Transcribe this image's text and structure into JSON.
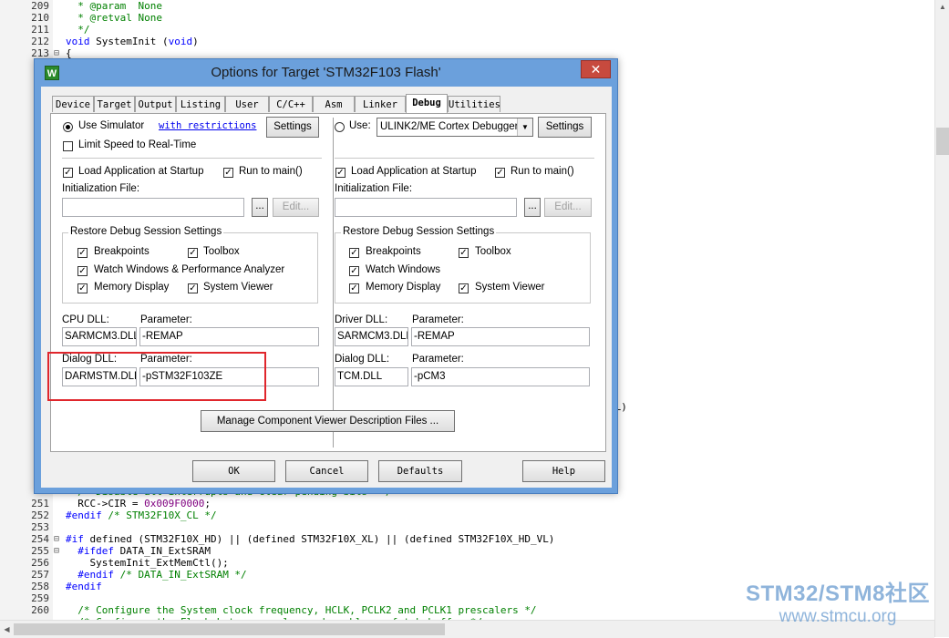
{
  "editor": {
    "lines": [
      {
        "n": "209",
        "fold": "",
        "html": [
          {
            "t": "  * @param  None",
            "c": "cmt"
          }
        ]
      },
      {
        "n": "210",
        "fold": "",
        "html": [
          {
            "t": "  * @retval None",
            "c": "cmt"
          }
        ]
      },
      {
        "n": "211",
        "fold": "",
        "html": [
          {
            "t": "  */",
            "c": "cmt"
          }
        ]
      },
      {
        "n": "212",
        "fold": "",
        "html": [
          {
            "t": "void",
            "c": "kw"
          },
          {
            "t": " SystemInit (",
            "c": ""
          },
          {
            "t": "void",
            "c": "kw"
          },
          {
            "t": ")",
            "c": ""
          }
        ]
      },
      {
        "n": "213",
        "fold": "⊟",
        "html": [
          {
            "t": "{",
            "c": ""
          }
        ]
      },
      {
        "n": "",
        "fold": "",
        "html": [
          {
            "t": "  /* Disable all interrupts and clear pending bits  */",
            "c": "cmt"
          }
        ]
      },
      {
        "n": "251",
        "fold": "",
        "html": [
          {
            "t": "  RCC->CIR = ",
            "c": ""
          },
          {
            "t": "0x009F0000",
            "c": "num"
          },
          {
            "t": ";",
            "c": ""
          }
        ]
      },
      {
        "n": "252",
        "fold": "",
        "html": [
          {
            "t": "#endif",
            "c": "pp"
          },
          {
            "t": " /* STM32F10X_CL */",
            "c": "cmt"
          }
        ]
      },
      {
        "n": "253",
        "fold": "",
        "html": [
          {
            "t": "",
            "c": ""
          }
        ]
      },
      {
        "n": "254",
        "fold": "⊟",
        "html": [
          {
            "t": "#if",
            "c": "pp"
          },
          {
            "t": " defined (STM32F10X_HD) || (defined STM32F10X_XL) || (defined STM32F10X_HD_VL)",
            "c": ""
          }
        ]
      },
      {
        "n": "255",
        "fold": "⊟",
        "html": [
          {
            "t": "  #ifdef",
            "c": "pp"
          },
          {
            "t": " DATA_IN_ExtSRAM",
            "c": ""
          }
        ]
      },
      {
        "n": "256",
        "fold": "",
        "html": [
          {
            "t": "    SystemInit_ExtMemCtl();",
            "c": ""
          }
        ]
      },
      {
        "n": "257",
        "fold": "",
        "html": [
          {
            "t": "  #endif",
            "c": "pp"
          },
          {
            "t": " /* DATA_IN_ExtSRAM */",
            "c": "cmt"
          }
        ]
      },
      {
        "n": "258",
        "fold": "",
        "html": [
          {
            "t": "#endif",
            "c": "pp"
          }
        ]
      },
      {
        "n": "259",
        "fold": "",
        "html": [
          {
            "t": "",
            "c": ""
          }
        ]
      },
      {
        "n": "260",
        "fold": "",
        "html": [
          {
            "t": "  /* Configure the System clock frequency, HCLK, PCLK2 and PCLK1 prescalers */",
            "c": "cmt"
          }
        ]
      },
      {
        "n": "",
        "fold": "",
        "html": [
          {
            "t": "  /* Configure the Flash Latency cycles and enable prefetch buffer */",
            "c": "cmt"
          }
        ]
      }
    ],
    "peek_text": "VL)"
  },
  "watermark": {
    "line1": "STM32/STM8社区",
    "line2": "www.stmcu.org"
  },
  "dialog": {
    "title": "Options for Target 'STM32F103 Flash'",
    "app_icon": "W",
    "close_glyph": "✕",
    "tabs": [
      "Device",
      "Target",
      "Output",
      "Listing",
      "User",
      "C/C++",
      "Asm",
      "Linker",
      "Debug",
      "Utilities"
    ],
    "active_tab": "Debug",
    "left": {
      "use_simulator": "Use Simulator",
      "with_restrictions": "with restrictions",
      "settings": "Settings",
      "limit_speed": "Limit Speed to Real-Time",
      "load_app": "Load Application at Startup",
      "run_to_main": "Run to main()",
      "init_file": "Initialization File:",
      "init_value": "",
      "browse": "...",
      "edit": "Edit...",
      "restore_group": "Restore Debug Session Settings",
      "breakpoints": "Breakpoints",
      "toolbox": "Toolbox",
      "watch_windows": "Watch Windows & Performance Analyzer",
      "memory_display": "Memory Display",
      "system_viewer": "System Viewer",
      "cpu_dll_label": "CPU DLL:",
      "parameter_label": "Parameter:",
      "cpu_dll": "SARMCM3.DLL",
      "cpu_param": "-REMAP",
      "dialog_dll_label": "Dialog DLL:",
      "dialog_dll": "DARMSTM.DLL",
      "dialog_param": "-pSTM32F103ZE"
    },
    "right": {
      "use": "Use:",
      "debugger": "ULINK2/ME Cortex Debugger",
      "settings": "Settings",
      "load_app": "Load Application at Startup",
      "run_to_main": "Run to main()",
      "init_file": "Initialization File:",
      "init_value": "",
      "browse": "...",
      "edit": "Edit...",
      "restore_group": "Restore Debug Session Settings",
      "breakpoints": "Breakpoints",
      "toolbox": "Toolbox",
      "watch_windows": "Watch Windows",
      "memory_display": "Memory Display",
      "system_viewer": "System Viewer",
      "driver_dll_label": "Driver DLL:",
      "parameter_label": "Parameter:",
      "driver_dll": "SARMCM3.DLL",
      "driver_param": "-REMAP",
      "dialog_dll_label": "Dialog DLL:",
      "dialog_dll": "TCM.DLL",
      "dialog_param": "-pCM3"
    },
    "manage_button": "Manage Component Viewer Description Files ...",
    "buttons": {
      "ok": "OK",
      "cancel": "Cancel",
      "defaults": "Defaults",
      "help": "Help"
    },
    "check_glyph": "✓",
    "dropdown_glyph": "▼"
  },
  "scrollbar_glyphs": {
    "up": "▲",
    "down": "▼",
    "left": "◀",
    "right": "▶"
  }
}
